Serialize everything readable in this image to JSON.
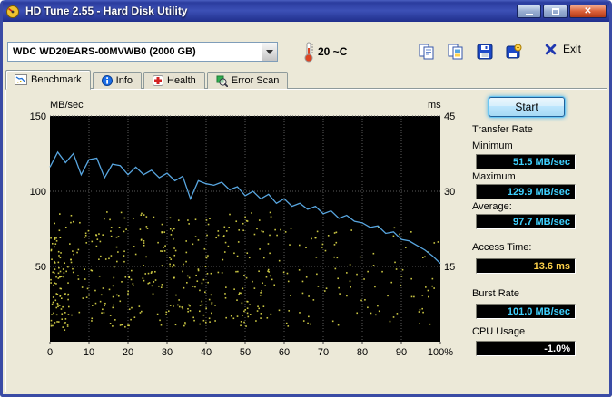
{
  "window": {
    "title": "HD Tune 2.55 - Hard Disk Utility"
  },
  "toolbar": {
    "drive": "WDC WD20EARS-00MVWB0 (2000 GB)",
    "temperature": "20 ~C",
    "exit_label": "Exit"
  },
  "tabs": {
    "benchmark": "Benchmark",
    "info": "Info",
    "health": "Health",
    "error_scan": "Error Scan"
  },
  "results": {
    "start_label": "Start",
    "transfer_rate_title": "Transfer Rate",
    "minimum_label": "Minimum",
    "minimum_value": "51.5 MB/sec",
    "maximum_label": "Maximum",
    "maximum_value": "129.9 MB/sec",
    "average_label": "Average:",
    "average_value": "97.7 MB/sec",
    "access_time_label": "Access Time:",
    "access_time_value": "13.6 ms",
    "burst_rate_label": "Burst Rate",
    "burst_rate_value": "101.0 MB/sec",
    "cpu_usage_label": "CPU Usage",
    "cpu_usage_value": "-1.0%"
  },
  "colors": {
    "value_cyan": "#3fd1ff",
    "value_yellow": "#ffd24a",
    "value_white": "#ffffff",
    "line_blue": "#58a6e0",
    "scatter_yellow": "#e0dc4a",
    "grid_grey": "#5a5a5a",
    "plot_black": "#000000"
  },
  "chart_data": {
    "type": "line+scatter",
    "title": "HD Tune benchmark: transfer rate line (MB/sec) and access time scatter (ms) vs position (%)",
    "left_axis": {
      "label": "MB/sec",
      "ticks": [
        150,
        100,
        50
      ],
      "min": 0,
      "max": 150
    },
    "right_axis": {
      "label": "ms",
      "ticks": [
        45,
        30,
        15
      ],
      "min": 0,
      "max": 45
    },
    "x_axis": {
      "ticks": [
        0,
        10,
        20,
        30,
        40,
        50,
        60,
        70,
        80,
        90,
        100
      ],
      "tick_labels": [
        "0",
        "10",
        "20",
        "30",
        "40",
        "50",
        "60",
        "70",
        "80",
        "90",
        "100%"
      ],
      "min": 0,
      "max": 100
    },
    "transfer_rate": {
      "units": "MB/sec",
      "x_step": 2,
      "values": [
        116,
        126,
        119,
        125,
        111,
        121,
        122,
        109,
        118,
        117,
        111,
        116,
        111,
        114,
        109,
        112,
        107,
        110,
        95,
        107,
        105,
        104,
        106,
        101,
        103,
        97,
        100,
        95,
        98,
        92,
        95,
        90,
        92,
        88,
        90,
        85,
        87,
        82,
        84,
        80,
        79,
        76,
        77,
        72,
        73,
        68,
        67,
        64,
        61,
        57,
        52
      ]
    },
    "access_time_scatter": {
      "units": "ms",
      "seed": 1337,
      "groups": [
        {
          "count": 380,
          "x_min": 0,
          "x_max": 58,
          "ms_min": 3,
          "ms_max": 26
        },
        {
          "count": 110,
          "x_min": 58,
          "x_max": 100,
          "ms_min": 3,
          "ms_max": 23
        },
        {
          "count": 70,
          "x_min": 0,
          "x_max": 5,
          "ms_min": 2,
          "ms_max": 21
        }
      ]
    }
  }
}
